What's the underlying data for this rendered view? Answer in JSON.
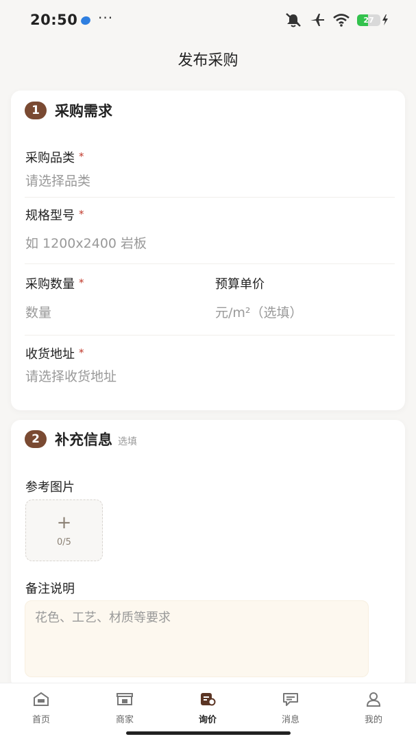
{
  "status_bar": {
    "time": "20:50",
    "more": "···",
    "battery": "27"
  },
  "header": {
    "title": "发布采购"
  },
  "section1": {
    "step": "1",
    "title": "采购需求",
    "fields": {
      "category": {
        "label": "采购品类",
        "placeholder": "请选择品类"
      },
      "spec": {
        "label": "规格型号",
        "placeholder": "如 1200x2400 岩板"
      },
      "quantity": {
        "label": "采购数量",
        "placeholder": "数量"
      },
      "unit_price": {
        "label": "预算单价",
        "placeholder": "元/m²（选填）"
      },
      "address": {
        "label": "收货地址",
        "placeholder": "请选择收货地址"
      }
    },
    "required_mark": "*"
  },
  "section2": {
    "step": "2",
    "title": "补充信息",
    "optional": "选填",
    "images_label": "参考图片",
    "upload_plus": "+",
    "upload_count": "0/5",
    "remark_label": "备注说明",
    "remark_placeholder": "花色、工艺、材质等要求"
  },
  "tabs": [
    {
      "label": "首页",
      "icon": "home-icon"
    },
    {
      "label": "商家",
      "icon": "store-icon"
    },
    {
      "label": "询价",
      "icon": "inquiry-icon",
      "active": true
    },
    {
      "label": "消息",
      "icon": "message-icon"
    },
    {
      "label": "我的",
      "icon": "profile-icon"
    }
  ],
  "colors": {
    "accent": "#7a4a32",
    "required": "#c0392b",
    "remark_bg": "#fdf8ef"
  }
}
